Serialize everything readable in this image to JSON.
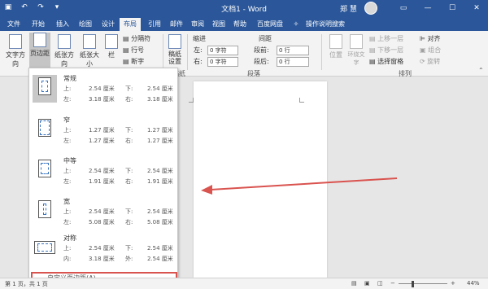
{
  "app": {
    "title": "文档1 - Word",
    "user": "郑 慧",
    "window_controls": [
      "ribbon-display",
      "minimize",
      "maximize",
      "close"
    ]
  },
  "qat": {
    "icons": [
      "save-icon",
      "undo-icon",
      "redo-icon",
      "customize-icon"
    ]
  },
  "tabs": [
    "文件",
    "开始",
    "插入",
    "绘图",
    "设计",
    "布局",
    "引用",
    "邮件",
    "审阅",
    "视图",
    "帮助",
    "百度网盘",
    "操作说明搜索"
  ],
  "active_tab": "布局",
  "ribbon": {
    "text_direction": "文字方向",
    "margins": "页边距",
    "orientation": "纸张方向",
    "size": "纸张大小",
    "columns": "栏",
    "breaks": "分隔符",
    "line_numbers": "行号",
    "hyphenation": "断字",
    "manuscript": "稿纸\n设置",
    "manuscript_group": "稿纸",
    "indent_label": "缩进",
    "spacing_label": "间距",
    "indent_left_label": "左:",
    "indent_left_value": "0 字符",
    "indent_right_label": "右:",
    "indent_right_value": "0 字符",
    "space_before_label": "段前:",
    "space_before_value": "0 行",
    "space_after_label": "段后:",
    "space_after_value": "0 行",
    "paragraph_group": "段落",
    "position": "位置",
    "wrap_text": "环绕文字",
    "bring_forward": "上移一层",
    "send_backward": "下移一层",
    "selection_pane": "选择窗格",
    "align": "对齐",
    "group": "组合",
    "rotate": "旋转",
    "arrange_group": "排列"
  },
  "margins_menu": {
    "items": [
      {
        "name": "常规",
        "top_label": "上:",
        "top": "2.54 厘米",
        "bottom_label": "下:",
        "bottom": "2.54 厘米",
        "left_label": "左:",
        "left": "3.18 厘米",
        "right_label": "右:",
        "right": "3.18 厘米"
      },
      {
        "name": "窄",
        "top_label": "上:",
        "top": "1.27 厘米",
        "bottom_label": "下:",
        "bottom": "1.27 厘米",
        "left_label": "左:",
        "left": "1.27 厘米",
        "right_label": "右:",
        "right": "1.27 厘米"
      },
      {
        "name": "中等",
        "top_label": "上:",
        "top": "2.54 厘米",
        "bottom_label": "下:",
        "bottom": "2.54 厘米",
        "left_label": "左:",
        "left": "1.91 厘米",
        "right_label": "右:",
        "right": "1.91 厘米"
      },
      {
        "name": "宽",
        "top_label": "上:",
        "top": "2.54 厘米",
        "bottom_label": "下:",
        "bottom": "2.54 厘米",
        "left_label": "左:",
        "left": "5.08 厘米",
        "right_label": "右:",
        "right": "5.08 厘米"
      },
      {
        "name": "对称",
        "top_label": "上:",
        "top": "2.54 厘米",
        "bottom_label": "下:",
        "bottom": "2.54 厘米",
        "left_label": "内:",
        "left": "3.18 厘米",
        "right_label": "外:",
        "right": "2.54 厘米"
      }
    ],
    "custom": "自定义页边距(A)..."
  },
  "status": {
    "page": "第 1 页，共 1 页",
    "zoom": "44%"
  },
  "colors": {
    "title_bar": "#2b579a",
    "arrow": "#d9534f",
    "highlight": "#d9534f"
  }
}
